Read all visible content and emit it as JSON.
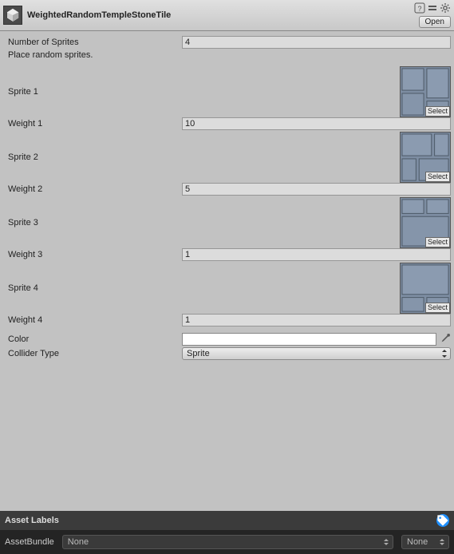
{
  "header": {
    "title": "WeightedRandomTempleStoneTile",
    "open_label": "Open"
  },
  "fields": {
    "num_sprites_label": "Number of Sprites",
    "num_sprites_value": "4",
    "description": "Place random sprites.",
    "sprite1_label": "Sprite 1",
    "weight1_label": "Weight 1",
    "weight1_value": "10",
    "sprite2_label": "Sprite 2",
    "weight2_label": "Weight 2",
    "weight2_value": "5",
    "sprite3_label": "Sprite 3",
    "weight3_label": "Weight 3",
    "weight3_value": "1",
    "sprite4_label": "Sprite 4",
    "weight4_label": "Weight 4",
    "weight4_value": "1",
    "select_label": "Select",
    "color_label": "Color",
    "color_value": "#ffffff",
    "collider_label": "Collider Type",
    "collider_value": "Sprite"
  },
  "asset_labels_title": "Asset Labels",
  "footer": {
    "assetbundle_label": "AssetBundle",
    "bundle_value": "None",
    "variant_value": "None"
  }
}
